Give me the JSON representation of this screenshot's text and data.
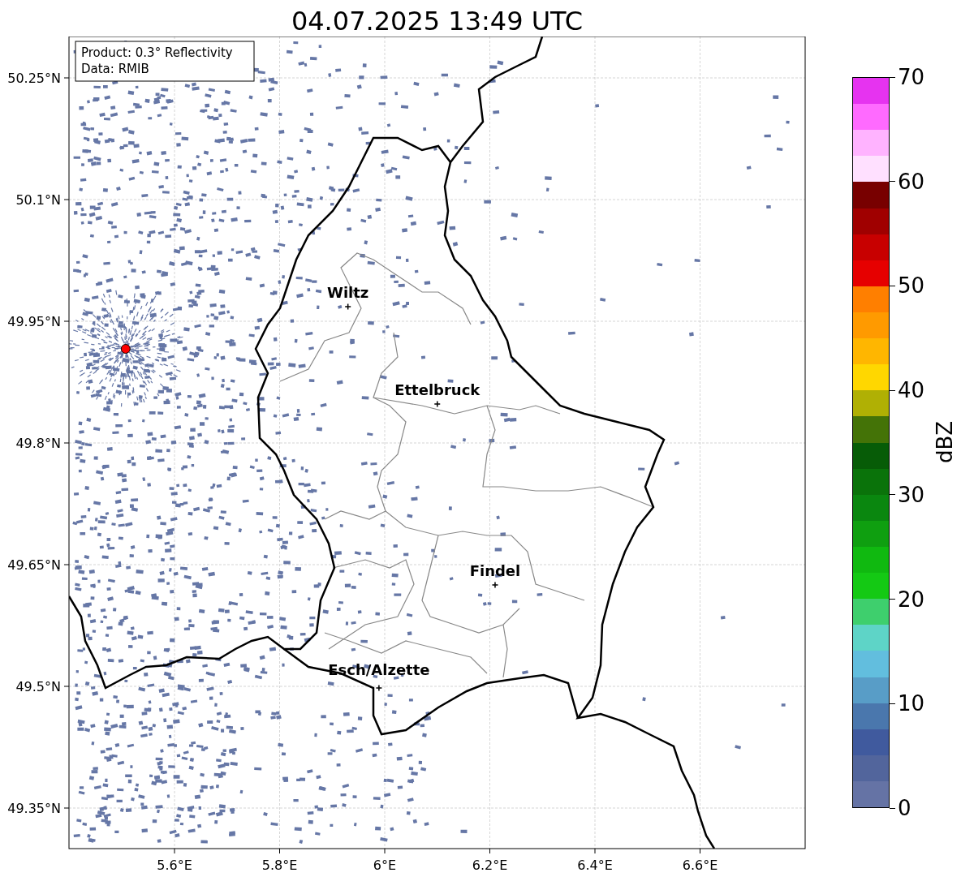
{
  "title": "04.07.2025 13:49 UTC",
  "info": [
    "Product: 0.3° Reflectivity",
    "Data: RMIB"
  ],
  "map": {
    "y_tick_labels": [
      "50.25°N",
      "50.1°N",
      "49.95°N",
      "49.8°N",
      "49.65°N",
      "49.5°N",
      "49.35°N"
    ],
    "x_tick_labels": [
      "5.6°E",
      "5.8°E",
      "6°E",
      "6.2°E",
      "6.4°E",
      "6.6°E"
    ],
    "cities": [
      {
        "name": "Wiltz"
      },
      {
        "name": "Ettelbruck"
      },
      {
        "name": "Findel"
      },
      {
        "name": "Esch/Alzette"
      }
    ]
  },
  "colorbar": {
    "label": "dBZ",
    "ticks": [
      "70",
      "60",
      "50",
      "40",
      "30",
      "20",
      "10",
      "0"
    ],
    "bins": [
      {
        "color": "#e633f0"
      },
      {
        "color": "#ff6aff"
      },
      {
        "color": "#ffb3ff"
      },
      {
        "color": "#ffe0ff"
      },
      {
        "color": "#780000"
      },
      {
        "color": "#a00000"
      },
      {
        "color": "#c80000"
      },
      {
        "color": "#e60000"
      },
      {
        "color": "#ff7f00"
      },
      {
        "color": "#ff9a00"
      },
      {
        "color": "#ffb600"
      },
      {
        "color": "#ffd700"
      },
      {
        "color": "#b0b004"
      },
      {
        "color": "#447307"
      },
      {
        "color": "#075c07"
      },
      {
        "color": "#0a730a"
      },
      {
        "color": "#0a870f"
      },
      {
        "color": "#0f9f10"
      },
      {
        "color": "#10b910"
      },
      {
        "color": "#14c914"
      },
      {
        "color": "#3ecf6d"
      },
      {
        "color": "#5ed4c7"
      },
      {
        "color": "#62bede"
      },
      {
        "color": "#589dc7"
      },
      {
        "color": "#4a77ad"
      },
      {
        "color": "#405a9e"
      },
      {
        "color": "#52659c"
      },
      {
        "color": "#6573a5"
      }
    ]
  }
}
